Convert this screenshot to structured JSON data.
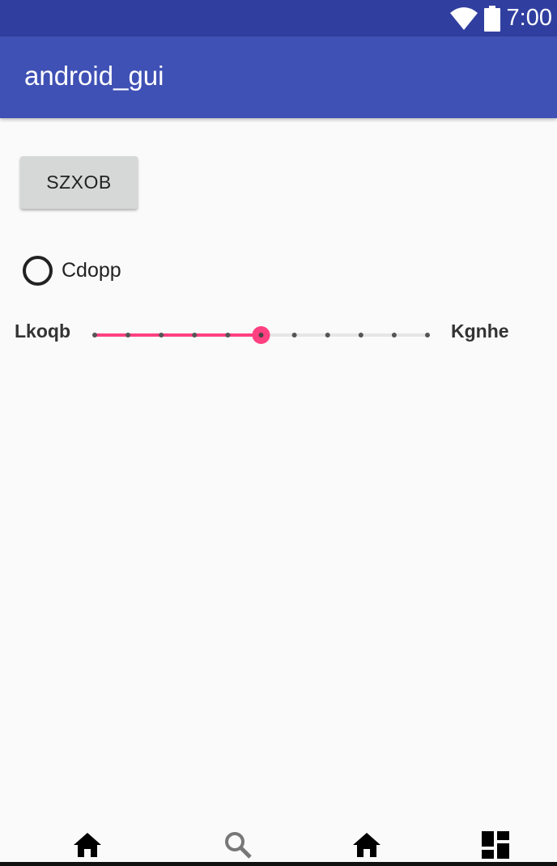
{
  "status_bar": {
    "time": "7:00"
  },
  "app_bar": {
    "title": "android_gui"
  },
  "button": {
    "label": "SZXOB"
  },
  "radio": {
    "label": "Cdopp",
    "checked": false
  },
  "seekbar": {
    "left_label": "Lkoqb",
    "right_label": "Kgnhe",
    "max": 10,
    "value": 5,
    "accent_color": "#ff4081"
  },
  "bottom_nav": {
    "items": [
      {
        "icon": "home-icon"
      },
      {
        "icon": "search-icon"
      },
      {
        "icon": "home-icon"
      },
      {
        "icon": "dashboard-icon"
      }
    ]
  },
  "colors": {
    "primary": "#3f51b5",
    "primary_dark": "#303f9f",
    "accent": "#ff4081"
  }
}
